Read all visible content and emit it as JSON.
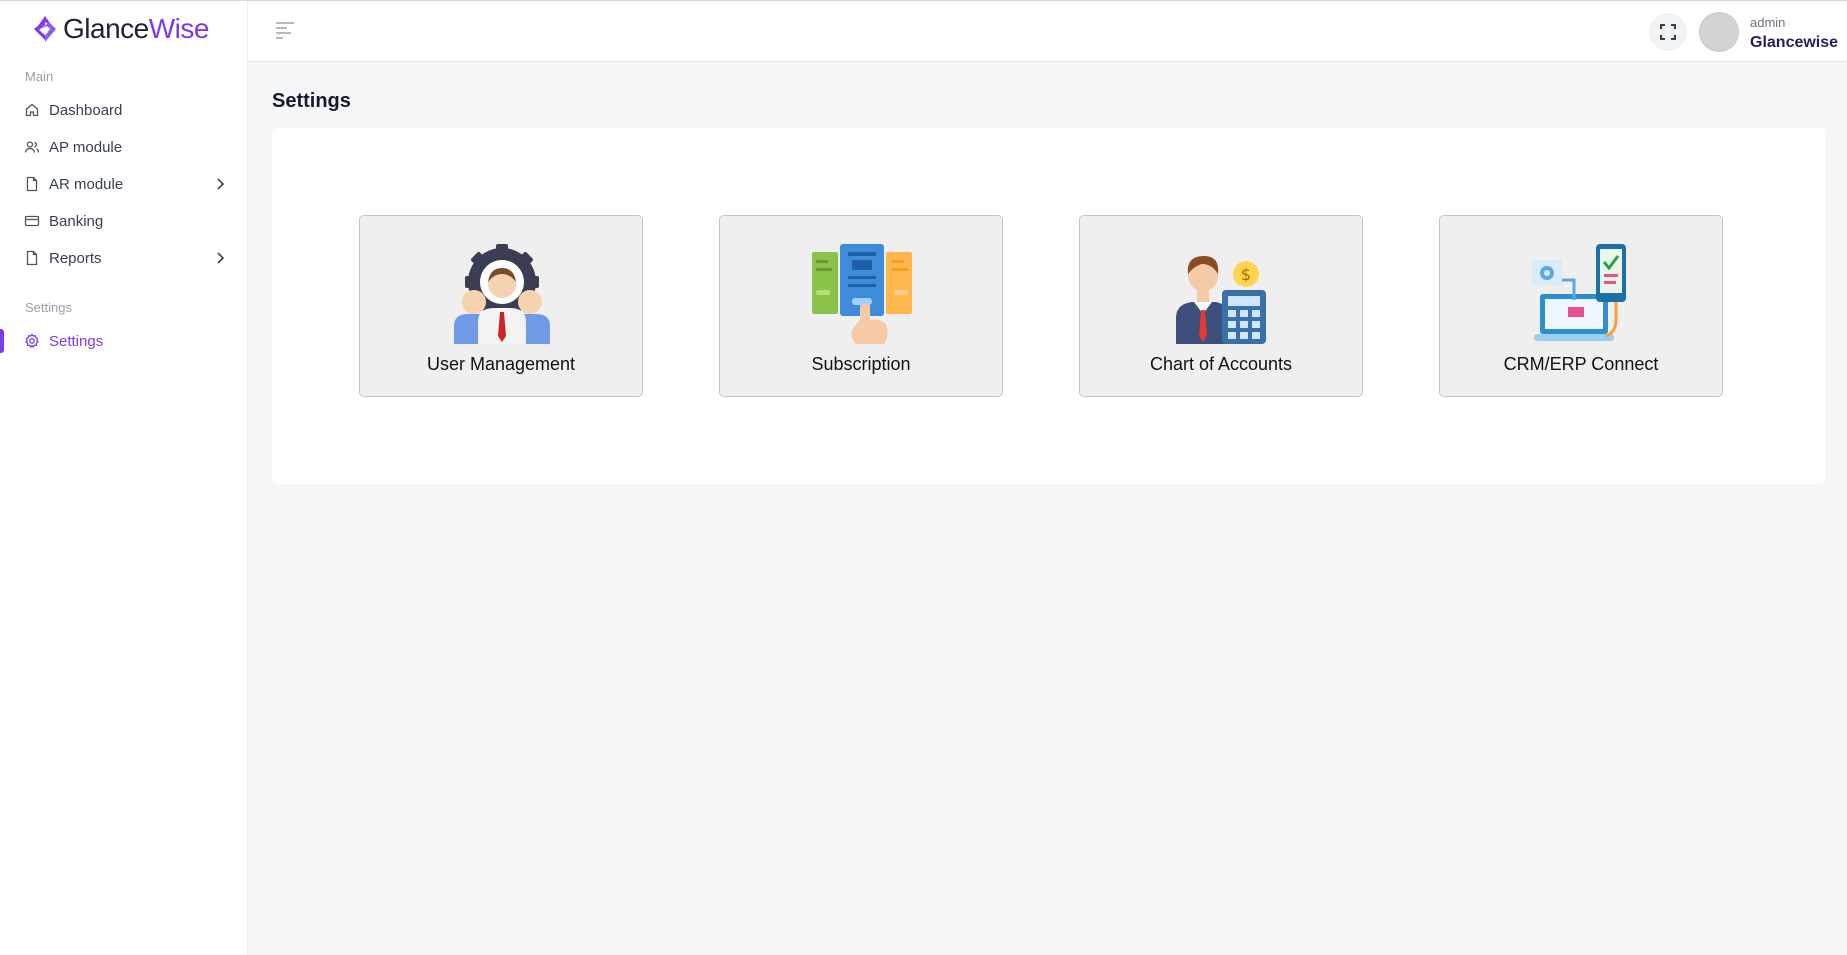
{
  "brand": {
    "name_part1": "Glance",
    "name_part2": "Wise",
    "accent": "#7c3aed"
  },
  "sidebar": {
    "sections": [
      {
        "label": "Main"
      },
      {
        "label": "Settings"
      }
    ],
    "items": [
      {
        "label": "Dashboard",
        "icon": "home-icon"
      },
      {
        "label": "AP module",
        "icon": "users-icon"
      },
      {
        "label": "AR module",
        "icon": "file-icon",
        "has_submenu": true
      },
      {
        "label": "Banking",
        "icon": "credit-card-icon"
      },
      {
        "label": "Reports",
        "icon": "file-icon",
        "has_submenu": true
      },
      {
        "label": "Settings",
        "icon": "gear-icon",
        "active": true
      }
    ]
  },
  "header": {
    "user": {
      "role": "admin",
      "name": "Glancewise"
    }
  },
  "page": {
    "title": "Settings",
    "tiles": [
      {
        "label": "User Management",
        "icon": "user-management-illustration"
      },
      {
        "label": "Subscription",
        "icon": "subscription-illustration"
      },
      {
        "label": "Chart of Accounts",
        "icon": "chart-of-accounts-illustration"
      },
      {
        "label": "CRM/ERP Connect",
        "icon": "crm-erp-connect-illustration"
      }
    ]
  }
}
